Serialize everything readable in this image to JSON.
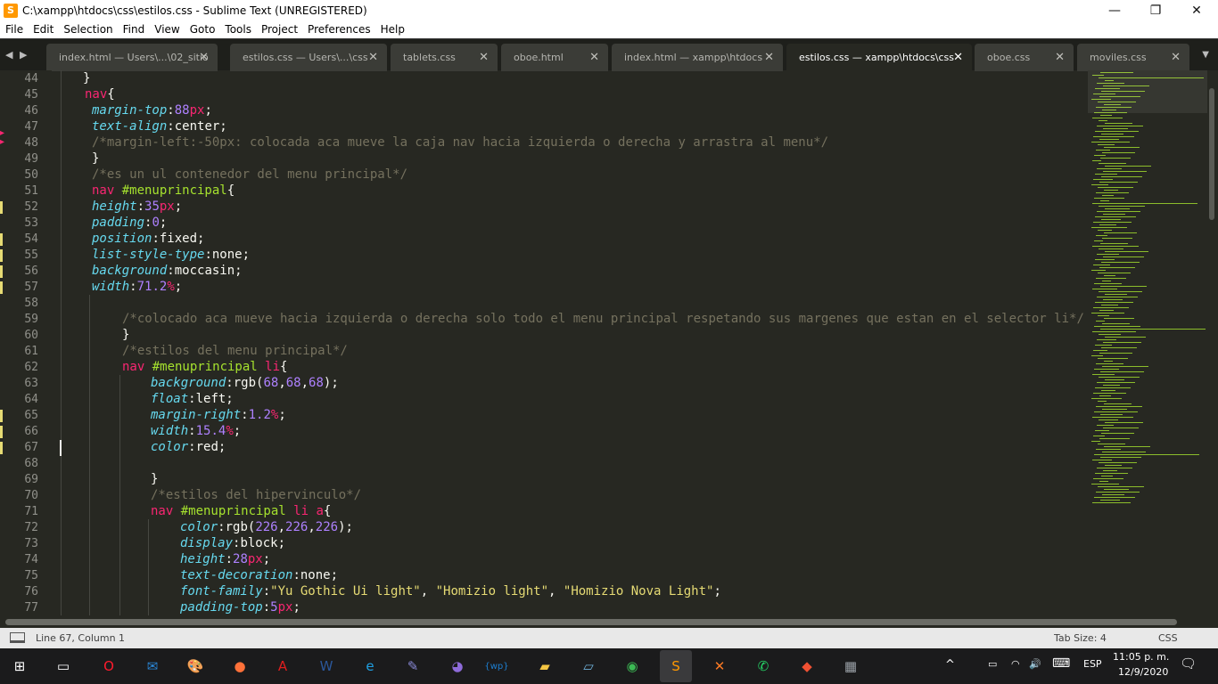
{
  "window": {
    "title": "C:\\xampp\\htdocs\\css\\estilos.css - Sublime Text (UNREGISTERED)",
    "app_icon": "sublime-icon",
    "controls": {
      "minimize": "—",
      "maximize": "❐",
      "close": "✕"
    }
  },
  "menu": [
    "File",
    "Edit",
    "Selection",
    "Find",
    "View",
    "Goto",
    "Tools",
    "Project",
    "Preferences",
    "Help"
  ],
  "tabs": [
    {
      "label": "index.html — Users\\...\\02_sitio",
      "close": "✕",
      "active": false
    },
    {
      "label": "estilos.css — Users\\...\\css",
      "close": "✕",
      "active": false
    },
    {
      "label": "tablets.css",
      "close": "✕",
      "active": false
    },
    {
      "label": "oboe.html",
      "close": "✕",
      "active": false
    },
    {
      "label": "index.html — xampp\\htdocs",
      "close": "✕",
      "active": false
    },
    {
      "label": "estilos.css — xampp\\htdocs\\css",
      "close": "✕",
      "active": true
    },
    {
      "label": "oboe.css",
      "close": "✕",
      "active": false
    },
    {
      "label": "moviles.css",
      "close": "✕",
      "active": false
    }
  ],
  "tab_nav": "◀ ▶",
  "tab_menu": "▼",
  "editor": {
    "line_numbers": [
      "44",
      "45",
      "46",
      "47",
      "48",
      "49",
      "50",
      "51",
      "52",
      "53",
      "54",
      "55",
      "56",
      "57",
      "58",
      "59",
      "60",
      "61",
      "62",
      "63",
      "64",
      "65",
      "66",
      "67",
      "68",
      "69",
      "70",
      "71",
      "72",
      "73",
      "74",
      "75",
      "76",
      "77"
    ],
    "modified_lines": [
      "52",
      "54",
      "55",
      "56",
      "57",
      "65",
      "66",
      "67"
    ],
    "error_markers": [
      "47",
      "48"
    ],
    "lines": [
      [
        {
          "t": "}",
          "c": ""
        }
      ],
      [
        {
          "t": "nav",
          "c": "sel"
        },
        {
          "t": "{",
          "c": ""
        }
      ],
      [
        {
          "t": "margin-top",
          "c": "prop"
        },
        {
          "t": ":",
          "c": ""
        },
        {
          "t": "88",
          "c": "num"
        },
        {
          "t": "px",
          "c": "unit"
        },
        {
          "t": ";",
          "c": ""
        }
      ],
      [
        {
          "t": "text-align",
          "c": "prop"
        },
        {
          "t": ":center;",
          "c": ""
        }
      ],
      [
        {
          "t": "/*margin-left:-50px: colocada aca mueve la caja nav hacia izquierda o derecha y arrastra al menu*/",
          "c": "com"
        }
      ],
      [
        {
          "t": "}",
          "c": ""
        }
      ],
      [
        {
          "t": "/*es un ul contenedor del menu principal*/",
          "c": "com"
        }
      ],
      [
        {
          "t": "nav ",
          "c": "sel"
        },
        {
          "t": "#menuprincipal",
          "c": "id"
        },
        {
          "t": "{",
          "c": ""
        }
      ],
      [
        {
          "t": "height",
          "c": "prop"
        },
        {
          "t": ":",
          "c": ""
        },
        {
          "t": "35",
          "c": "num"
        },
        {
          "t": "px",
          "c": "unit"
        },
        {
          "t": ";",
          "c": ""
        }
      ],
      [
        {
          "t": "padding",
          "c": "prop"
        },
        {
          "t": ":",
          "c": ""
        },
        {
          "t": "0",
          "c": "num"
        },
        {
          "t": ";",
          "c": ""
        }
      ],
      [
        {
          "t": "position",
          "c": "prop"
        },
        {
          "t": ":fixed;",
          "c": ""
        }
      ],
      [
        {
          "t": "list-style-type",
          "c": "prop"
        },
        {
          "t": ":none;",
          "c": ""
        }
      ],
      [
        {
          "t": "background",
          "c": "prop"
        },
        {
          "t": ":moccasin;",
          "c": ""
        }
      ],
      [
        {
          "t": "width",
          "c": "prop"
        },
        {
          "t": ":",
          "c": ""
        },
        {
          "t": "71.2",
          "c": "num"
        },
        {
          "t": "%",
          "c": "unit"
        },
        {
          "t": ";",
          "c": ""
        }
      ],
      [],
      [
        {
          "t": "/*colocado aca mueve hacia izquierda o derecha solo todo el menu principal respetando sus margenes que estan en el selector li*/",
          "c": "com"
        }
      ],
      [
        {
          "t": "}",
          "c": ""
        }
      ],
      [
        {
          "t": "/*estilos del menu principal*/",
          "c": "com"
        }
      ],
      [
        {
          "t": "nav ",
          "c": "sel"
        },
        {
          "t": "#menuprincipal ",
          "c": "id"
        },
        {
          "t": "li",
          "c": "sel"
        },
        {
          "t": "{",
          "c": ""
        }
      ],
      [
        {
          "t": "background",
          "c": "prop"
        },
        {
          "t": ":rgb(",
          "c": ""
        },
        {
          "t": "68",
          "c": "num"
        },
        {
          "t": ",",
          "c": ""
        },
        {
          "t": "68",
          "c": "num"
        },
        {
          "t": ",",
          "c": ""
        },
        {
          "t": "68",
          "c": "num"
        },
        {
          "t": ");",
          "c": ""
        }
      ],
      [
        {
          "t": "float",
          "c": "prop"
        },
        {
          "t": ":left;",
          "c": ""
        }
      ],
      [
        {
          "t": "margin-right",
          "c": "prop"
        },
        {
          "t": ":",
          "c": ""
        },
        {
          "t": "1.2",
          "c": "num"
        },
        {
          "t": "%",
          "c": "unit"
        },
        {
          "t": ";",
          "c": ""
        }
      ],
      [
        {
          "t": "width",
          "c": "prop"
        },
        {
          "t": ":",
          "c": ""
        },
        {
          "t": "15.4",
          "c": "num"
        },
        {
          "t": "%",
          "c": "unit"
        },
        {
          "t": ";",
          "c": ""
        }
      ],
      [
        {
          "t": "color",
          "c": "prop"
        },
        {
          "t": ":red;",
          "c": ""
        }
      ],
      [],
      [
        {
          "t": "}",
          "c": ""
        }
      ],
      [
        {
          "t": "/*estilos del hipervinculo*/",
          "c": "com"
        }
      ],
      [
        {
          "t": "nav ",
          "c": "sel"
        },
        {
          "t": "#menuprincipal ",
          "c": "id"
        },
        {
          "t": "li a",
          "c": "sel"
        },
        {
          "t": "{",
          "c": ""
        }
      ],
      [
        {
          "t": "color",
          "c": "prop"
        },
        {
          "t": ":rgb(",
          "c": ""
        },
        {
          "t": "226",
          "c": "num"
        },
        {
          "t": ",",
          "c": ""
        },
        {
          "t": "226",
          "c": "num"
        },
        {
          "t": ",",
          "c": ""
        },
        {
          "t": "226",
          "c": "num"
        },
        {
          "t": ");",
          "c": ""
        }
      ],
      [
        {
          "t": "display",
          "c": "prop"
        },
        {
          "t": ":block;",
          "c": ""
        }
      ],
      [
        {
          "t": "height",
          "c": "prop"
        },
        {
          "t": ":",
          "c": ""
        },
        {
          "t": "28",
          "c": "num"
        },
        {
          "t": "px",
          "c": "unit"
        },
        {
          "t": ";",
          "c": ""
        }
      ],
      [
        {
          "t": "text-decoration",
          "c": "prop"
        },
        {
          "t": ":none;",
          "c": ""
        }
      ],
      [
        {
          "t": "font-family",
          "c": "prop"
        },
        {
          "t": ":",
          "c": ""
        },
        {
          "t": "\"Yu Gothic Ui light\"",
          "c": "str"
        },
        {
          "t": ", ",
          "c": ""
        },
        {
          "t": "\"Homizio light\"",
          "c": "str"
        },
        {
          "t": ", ",
          "c": ""
        },
        {
          "t": "\"Homizio Nova Light\"",
          "c": "str"
        },
        {
          "t": ";",
          "c": ""
        }
      ],
      [
        {
          "t": "padding-top",
          "c": "prop"
        },
        {
          "t": ":",
          "c": ""
        },
        {
          "t": "5",
          "c": "num"
        },
        {
          "t": "px",
          "c": "unit"
        },
        {
          "t": ";",
          "c": ""
        }
      ]
    ]
  },
  "status": {
    "position": "Line 67, Column 1",
    "tab_size": "Tab Size: 4",
    "syntax": "CSS"
  },
  "taskbar": {
    "items": [
      {
        "name": "windows-start-icon",
        "glyph": "⊞",
        "color": "#ffffff"
      },
      {
        "name": "task-view-icon",
        "glyph": "▭",
        "color": "#ffffff"
      },
      {
        "name": "opera-icon",
        "glyph": "O",
        "color": "#ff1b2d"
      },
      {
        "name": "mail-icon",
        "glyph": "✉",
        "color": "#2b88d8"
      },
      {
        "name": "paint-icon",
        "glyph": "🎨",
        "color": "#f2c94c"
      },
      {
        "name": "firefox-icon",
        "glyph": "●",
        "color": "#ff7139"
      },
      {
        "name": "acrobat-icon",
        "glyph": "A",
        "color": "#e01e1e"
      },
      {
        "name": "word-icon",
        "glyph": "W",
        "color": "#2b579a"
      },
      {
        "name": "edge-icon",
        "glyph": "e",
        "color": "#1fa0e3"
      },
      {
        "name": "editor-icon",
        "glyph": "✎",
        "color": "#8a8ad8"
      },
      {
        "name": "github-icon",
        "glyph": "◕",
        "color": "#8e6bd9"
      },
      {
        "name": "brackets-icon",
        "glyph": "{wp}",
        "color": "#1d7fd1"
      },
      {
        "name": "file-explorer-icon",
        "glyph": "▰",
        "color": "#f4c542"
      },
      {
        "name": "notes-icon",
        "glyph": "▱",
        "color": "#6fb1d9"
      },
      {
        "name": "chrome-icon",
        "glyph": "◉",
        "color": "#3cba54"
      },
      {
        "name": "sublime-text-icon",
        "glyph": "S",
        "color": "#ff9800"
      },
      {
        "name": "xampp-icon",
        "glyph": "✕",
        "color": "#fb7a24"
      },
      {
        "name": "whatsapp-icon",
        "glyph": "✆",
        "color": "#25d366"
      },
      {
        "name": "git-icon",
        "glyph": "◆",
        "color": "#f05133"
      },
      {
        "name": "calculator-icon",
        "glyph": "▦",
        "color": "#9aa0a6"
      }
    ],
    "tray": {
      "chevron": "^",
      "wifi": "◠",
      "battery": "▭",
      "volume": "🔊",
      "keyboard": "⌨",
      "lang": "ESP",
      "time": "11:05 p. m.",
      "date": "12/9/2020",
      "notifications": "🗨"
    }
  }
}
